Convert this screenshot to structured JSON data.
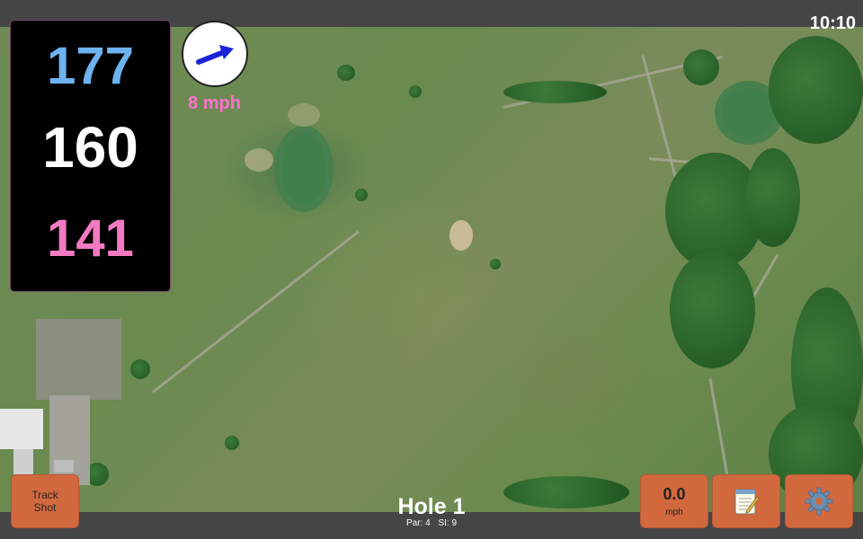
{
  "status": {
    "time": "10:10"
  },
  "distances": {
    "back": "177",
    "middle": "160",
    "front": "141"
  },
  "wind": {
    "speed": "8 mph",
    "direction_icon": "wind-arrow-icon"
  },
  "buttons": {
    "track_shot_line1": "Track",
    "track_shot_line2": "Shot",
    "speed_value": "0.0",
    "speed_unit": "mph",
    "notes_icon": "notepad-icon",
    "settings_icon": "gear-icon"
  },
  "hole": {
    "title": "Hole 1",
    "par": "Par: 4",
    "si": "SI: 9"
  },
  "colors": {
    "back_distance": "#6db3f2",
    "middle_distance": "#ffffff",
    "front_distance": "#f27ac2",
    "wind_text": "#ff72cf",
    "button_accent": "#d2693e"
  }
}
